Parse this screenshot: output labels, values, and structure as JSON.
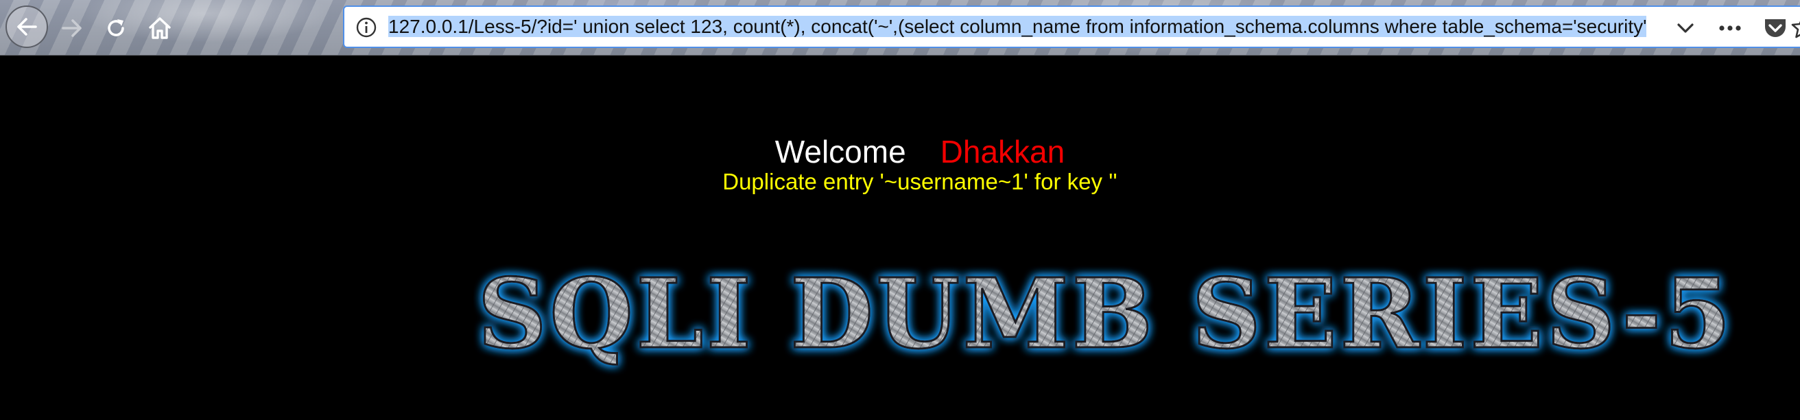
{
  "toolbar": {
    "icons": [
      "back-arrow-icon",
      "forward-arrow-icon",
      "reload-icon",
      "home-icon"
    ],
    "url": "127.0.0.1/Less-5/?id=' union select 123, count(*), concat('~',(select column_name from information_schema.columns where table_schema='security'",
    "url_icons": [
      "info-icon",
      "chevron-down-icon",
      "more-icon",
      "pocket-icon",
      "star-icon"
    ]
  },
  "page": {
    "welcome": "Welcome",
    "name": "Dhakkan",
    "error": "Duplicate entry '~username~1' for key ''",
    "banner": "SQLI DUMB SERIES-5"
  },
  "colors": {
    "background": "#000000",
    "name": "#f20000",
    "error": "#ffff00",
    "banner_glow": "#1ea0ff"
  }
}
